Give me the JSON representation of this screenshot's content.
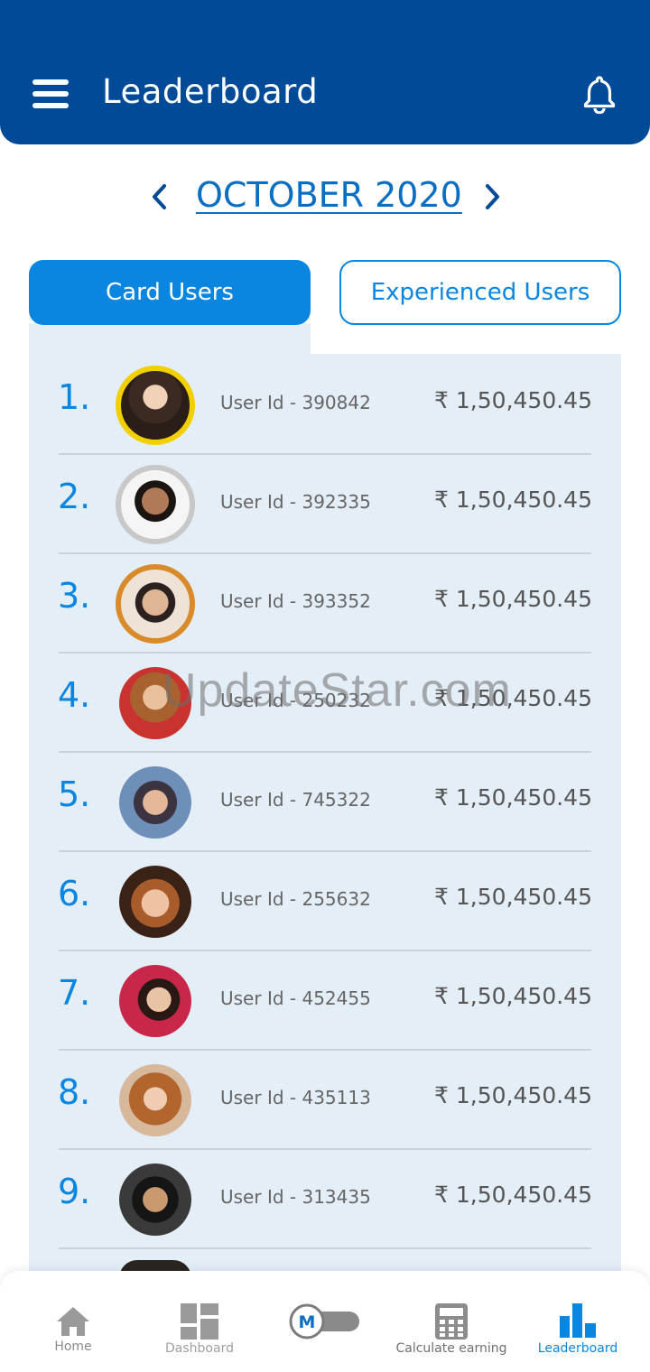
{
  "header": {
    "title": "Leaderboard"
  },
  "month": {
    "label": "OCTOBER 2020"
  },
  "tabs": [
    {
      "label": "Card Users",
      "active": true
    },
    {
      "label": "Experienced Users",
      "active": false
    }
  ],
  "leaderboard": [
    {
      "rank": "1.",
      "user_id": "User Id - 390842",
      "amount": "₹ 1,50,450.45",
      "medal": "gold"
    },
    {
      "rank": "2.",
      "user_id": "User Id - 392335",
      "amount": "₹ 1,50,450.45",
      "medal": "silver"
    },
    {
      "rank": "3.",
      "user_id": "User Id - 393352",
      "amount": "₹ 1,50,450.45",
      "medal": "bronze"
    },
    {
      "rank": "4.",
      "user_id": "User Id - 250232",
      "amount": "₹ 1,50,450.45"
    },
    {
      "rank": "5.",
      "user_id": "User Id - 745322",
      "amount": "₹ 1,50,450.45"
    },
    {
      "rank": "6.",
      "user_id": "User Id - 255632",
      "amount": "₹ 1,50,450.45"
    },
    {
      "rank": "7.",
      "user_id": "User Id - 452455",
      "amount": "₹ 1,50,450.45"
    },
    {
      "rank": "8.",
      "user_id": "User Id - 435113",
      "amount": "₹ 1,50,450.45"
    },
    {
      "rank": "9.",
      "user_id": "User Id - 313435",
      "amount": "₹ 1,50,450.45"
    }
  ],
  "watermark": "UpdateStar.com",
  "bottom_nav": [
    {
      "label": "Home",
      "icon": "home-icon"
    },
    {
      "label": "Dashboard",
      "icon": "dashboard-icon"
    },
    {
      "label": "",
      "icon": "mode-toggle-icon"
    },
    {
      "label": "Calculate earning",
      "icon": "calculator-icon"
    },
    {
      "label": "Leaderboard",
      "icon": "bar-chart-icon",
      "active": true
    }
  ],
  "colors": {
    "header": "#004a98",
    "accent": "#0a86e0",
    "panel": "#e4eef7",
    "gold": "#f2d000",
    "silver": "#c8c8c8",
    "bronze": "#d98a2b"
  }
}
